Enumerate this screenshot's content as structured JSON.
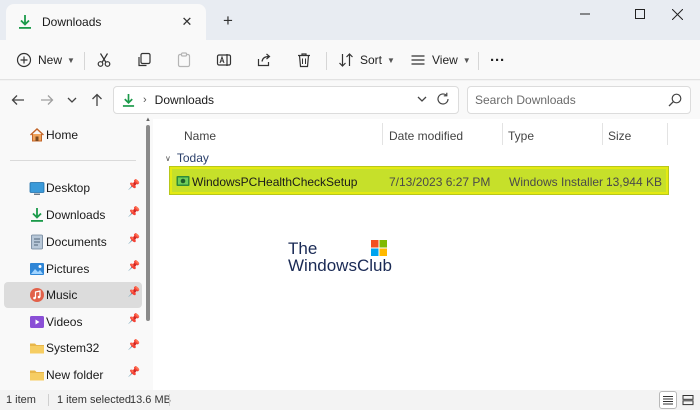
{
  "window": {
    "tab_title": "Downloads",
    "new_tab_symbol": "+"
  },
  "toolbar": {
    "new_label": "New",
    "sort_label": "Sort",
    "view_label": "View",
    "more_label": "···"
  },
  "address": {
    "current_folder": "Downloads",
    "search_placeholder": "Search Downloads"
  },
  "sidebar": {
    "items": [
      {
        "label": "Home",
        "icon": "home-icon",
        "pinned": false
      },
      {
        "label": "Desktop",
        "icon": "desktop-icon",
        "pinned": true
      },
      {
        "label": "Downloads",
        "icon": "download-icon",
        "pinned": true
      },
      {
        "label": "Documents",
        "icon": "documents-icon",
        "pinned": true
      },
      {
        "label": "Pictures",
        "icon": "pictures-icon",
        "pinned": true
      },
      {
        "label": "Music",
        "icon": "music-icon",
        "pinned": true
      },
      {
        "label": "Videos",
        "icon": "videos-icon",
        "pinned": true
      },
      {
        "label": "System32",
        "icon": "folder-icon",
        "pinned": true
      },
      {
        "label": "New folder",
        "icon": "folder-icon",
        "pinned": true
      }
    ],
    "selected": "Music"
  },
  "columns": {
    "name": "Name",
    "date": "Date modified",
    "type": "Type",
    "size": "Size"
  },
  "groups": [
    {
      "label": "Today",
      "files": [
        {
          "name": "WindowsPCHealthCheckSetup",
          "date": "7/13/2023 6:27 PM",
          "type": "Windows Installer ...",
          "size": "13,944 KB",
          "icon": "installer-icon",
          "selected": true
        }
      ]
    }
  ],
  "watermark": {
    "line1": "The",
    "line2": "WindowsClub"
  },
  "status": {
    "item_count": "1 item",
    "selected_count": "1 item selected",
    "selected_size": "13.6 MB"
  },
  "colors": {
    "accent": "#0078d4",
    "selection_highlight": "#c6e02a",
    "download_green": "#1b9a4a"
  }
}
